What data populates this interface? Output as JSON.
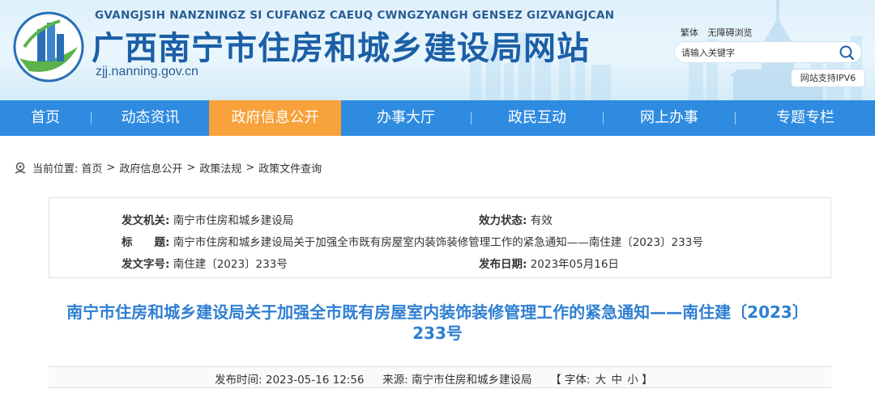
{
  "header": {
    "romanization": "GVANGJSIH NANZNINGZ SI CUFANGZ CAEUQ CWNGZYANGH GENSEZ GIZVANGJCAN",
    "title": "广西南宁市住房和城乡建设局网站",
    "domain": "zjj.nanning.gov.cn",
    "link_traditional": "繁体",
    "link_accessible": "无障碍浏览",
    "search_placeholder": "请输入关键字",
    "ipv6_badge": "网站支持IPV6",
    "colors": {
      "brand": "#1b5fa6",
      "nav": "#2f8be0",
      "nav_active": "#f7a23a"
    }
  },
  "nav": {
    "items": [
      {
        "label": "首页"
      },
      {
        "label": "动态资讯"
      },
      {
        "label": "政府信息公开",
        "active": true
      },
      {
        "label": "办事大厅"
      },
      {
        "label": "政民互动"
      },
      {
        "label": "网上办事"
      },
      {
        "label": "专题专栏"
      }
    ]
  },
  "breadcrumb": {
    "prefix": "当前位置:",
    "items": [
      "首页",
      "政府信息公开",
      "政策法规",
      "政策文件查询"
    ],
    "separator": ">"
  },
  "info": {
    "issuer_label": "发文机关:",
    "issuer": "南宁市住房和城乡建设局",
    "status_label": "效力状态:",
    "status": "有效",
    "title_label": "标　　题:",
    "title": "南宁市住房和城乡建设局关于加强全市既有房屋室内装饰装修管理工作的紧急通知——南住建〔2023〕233号",
    "docno_label": "发文字号:",
    "docno": "南住建〔2023〕233号",
    "date_label": "发布日期:",
    "date": "2023年05月16日"
  },
  "article": {
    "title_line1": "南宁市住房和城乡建设局关于加强全市既有房屋室内装饰装修管理工作的紧急通知——南住建〔2023〕",
    "title_line2": "233号",
    "published_label": "发布时间:",
    "published": "2023-05-16 12:56",
    "source_label": "来源:",
    "source": "南宁市住房和城乡建设局",
    "font_open": "【 字体:",
    "font_large": "大",
    "font_medium": "中",
    "font_small": "小",
    "font_close": "】"
  }
}
